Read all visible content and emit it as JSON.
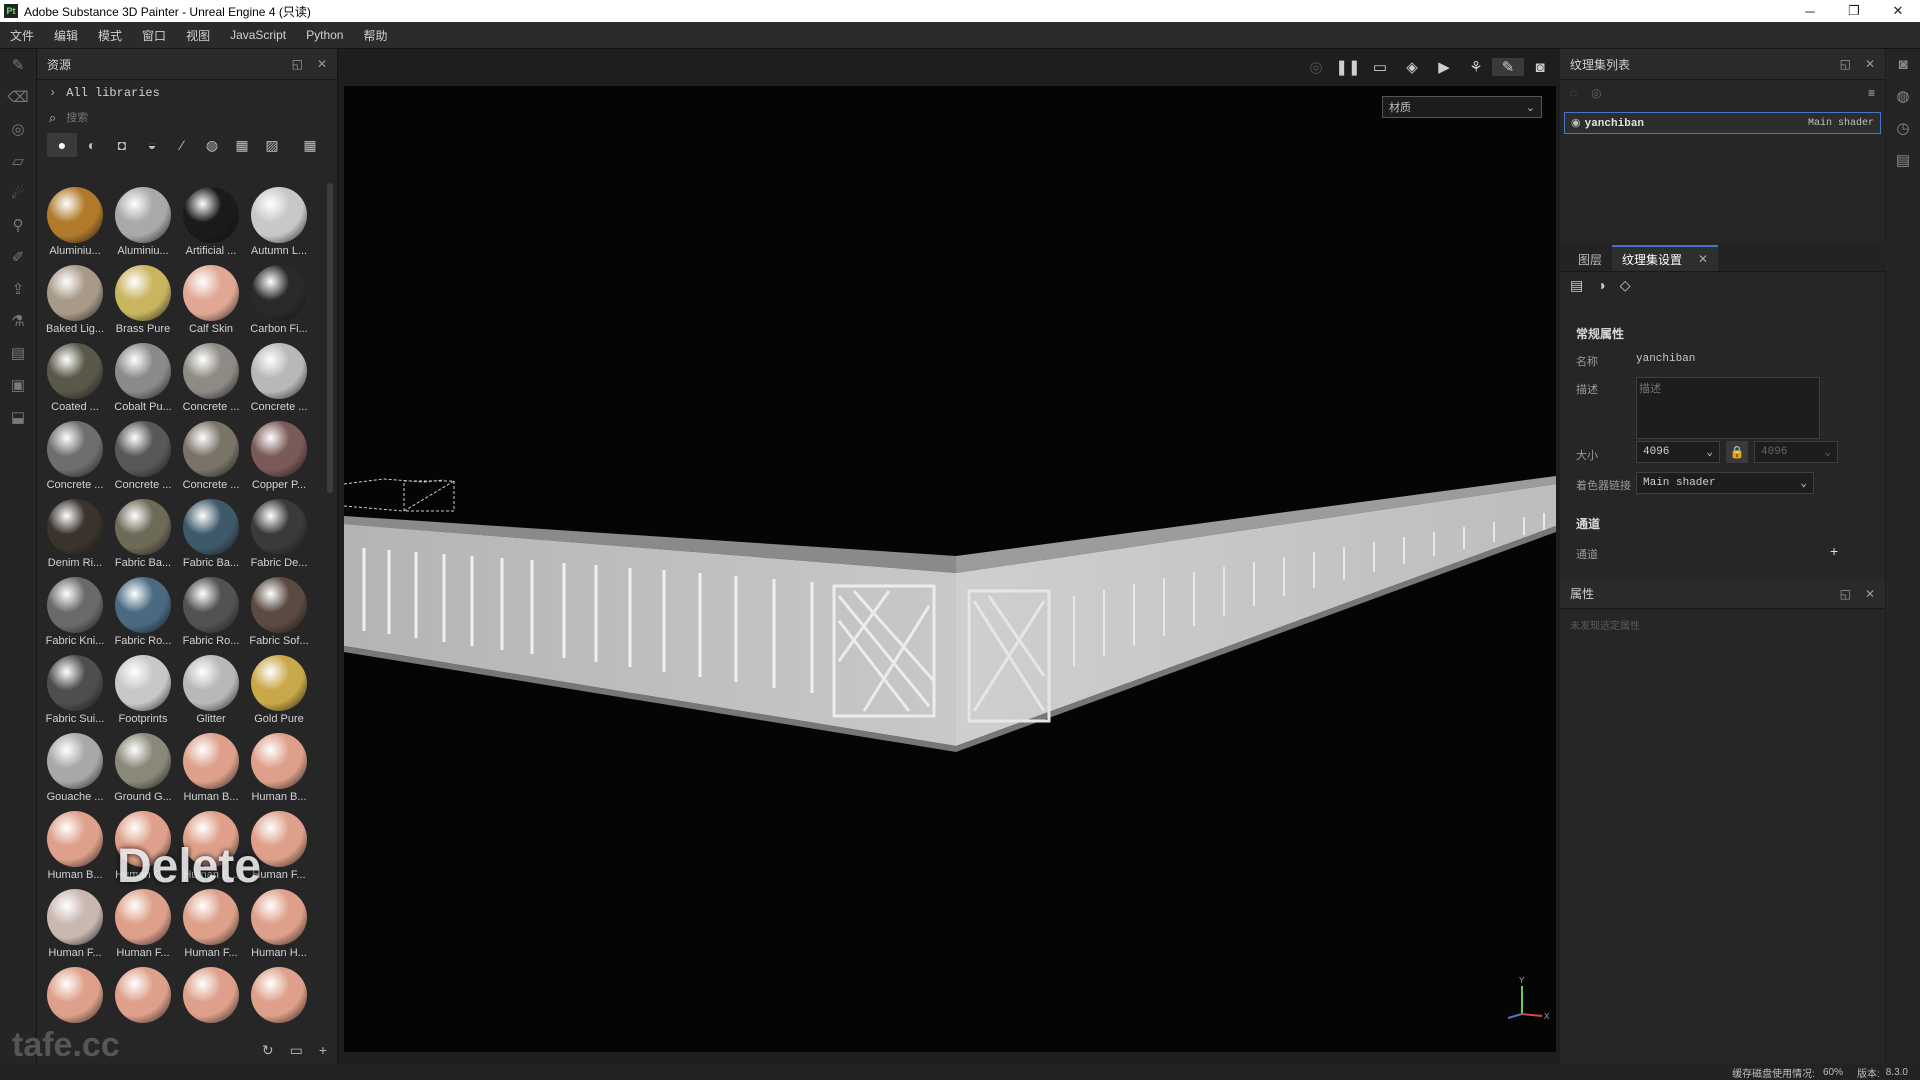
{
  "window": {
    "title": "Adobe Substance 3D Painter - Unreal Engine 4 (只读)",
    "logo": "Pt"
  },
  "menu": [
    "文件",
    "编辑",
    "模式",
    "窗口",
    "视图",
    "JavaScript",
    "Python",
    "帮助"
  ],
  "assets": {
    "title": "资源",
    "library": "All libraries",
    "search_placeholder": "搜索",
    "overlay_text": "Delete",
    "watermark": "tafe.cc",
    "materials": [
      {
        "label": "Aluminiu...",
        "color": "#b07a2a"
      },
      {
        "label": "Aluminiu...",
        "color": "#a9a9a9"
      },
      {
        "label": "Artificial ...",
        "color": "#1a1a1a"
      },
      {
        "label": "Autumn L...",
        "color": "#c8c8c8"
      },
      {
        "label": "Baked Lig...",
        "color": "#a89a88"
      },
      {
        "label": "Brass Pure",
        "color": "#c9b560"
      },
      {
        "label": "Calf Skin",
        "color": "#e0a894"
      },
      {
        "label": "Carbon Fi...",
        "color": "#2a2a2a"
      },
      {
        "label": "Coated ...",
        "color": "#5a5848"
      },
      {
        "label": "Cobalt Pu...",
        "color": "#8a8a8a"
      },
      {
        "label": "Concrete ...",
        "color": "#8e8a84"
      },
      {
        "label": "Concrete ...",
        "color": "#b8b8b8"
      },
      {
        "label": "Concrete ...",
        "color": "#6e6e6e"
      },
      {
        "label": "Concrete ...",
        "color": "#585858"
      },
      {
        "label": "Concrete ...",
        "color": "#7a7468"
      },
      {
        "label": "Copper P...",
        "color": "#7a5a58"
      },
      {
        "label": "Denim Ri...",
        "color": "#3a342c"
      },
      {
        "label": "Fabric Ba...",
        "color": "#6e6a58"
      },
      {
        "label": "Fabric Ba...",
        "color": "#3e5a6a"
      },
      {
        "label": "Fabric De...",
        "color": "#3a3a3a"
      },
      {
        "label": "Fabric Kni...",
        "color": "#6a6a6a"
      },
      {
        "label": "Fabric Ro...",
        "color": "#4a6a82"
      },
      {
        "label": "Fabric Ro...",
        "color": "#525252"
      },
      {
        "label": "Fabric Sof...",
        "color": "#5a4a42"
      },
      {
        "label": "Fabric Sui...",
        "color": "#4e4e4e"
      },
      {
        "label": "Footprints",
        "color": "#c8c8c8"
      },
      {
        "label": "Glitter",
        "color": "#b8b8b8"
      },
      {
        "label": "Gold Pure",
        "color": "#c8a848"
      },
      {
        "label": "Gouache ...",
        "color": "#a8a8a8"
      },
      {
        "label": "Ground G...",
        "color": "#8a8878"
      },
      {
        "label": "Human B...",
        "color": "#dea08a"
      },
      {
        "label": "Human B...",
        "color": "#dea08a"
      },
      {
        "label": "Human B...",
        "color": "#dea08a"
      },
      {
        "label": "Human C...",
        "color": "#dea08a"
      },
      {
        "label": "Human E...",
        "color": "#dea08a"
      },
      {
        "label": "Human F...",
        "color": "#dea08a"
      },
      {
        "label": "Human F...",
        "color": "#c8b8b0"
      },
      {
        "label": "Human F...",
        "color": "#dea08a"
      },
      {
        "label": "Human F...",
        "color": "#dea08a"
      },
      {
        "label": "Human H...",
        "color": "#dea08a"
      },
      {
        "label": "",
        "color": "#dea08a"
      },
      {
        "label": "",
        "color": "#dea08a"
      },
      {
        "label": "",
        "color": "#dea08a"
      },
      {
        "label": "",
        "color": "#dea08a"
      }
    ]
  },
  "viewport": {
    "material_mode": "材质"
  },
  "texture_set_list": {
    "title": "纹理集列表",
    "item_name": "yanchiban",
    "item_shader": "Main shader"
  },
  "settings": {
    "tabs": [
      "图层",
      "纹理集设置"
    ],
    "section_general": "常规属性",
    "name_label": "名称",
    "name_value": "yanchiban",
    "desc_label": "描述",
    "desc_placeholder": "描述",
    "size_label": "大小",
    "size_value": "4096",
    "size_value_locked": "4096",
    "shader_label": "着色器链接",
    "shader_value": "Main shader",
    "section_channels": "通道",
    "channels_label": "通道"
  },
  "properties": {
    "title": "属性",
    "empty_text": "未发现选定属性"
  },
  "status": {
    "text": "缓存磁盘使用情况:",
    "usage": "60%",
    "version_label": "版本:",
    "version": "8.3.0"
  }
}
